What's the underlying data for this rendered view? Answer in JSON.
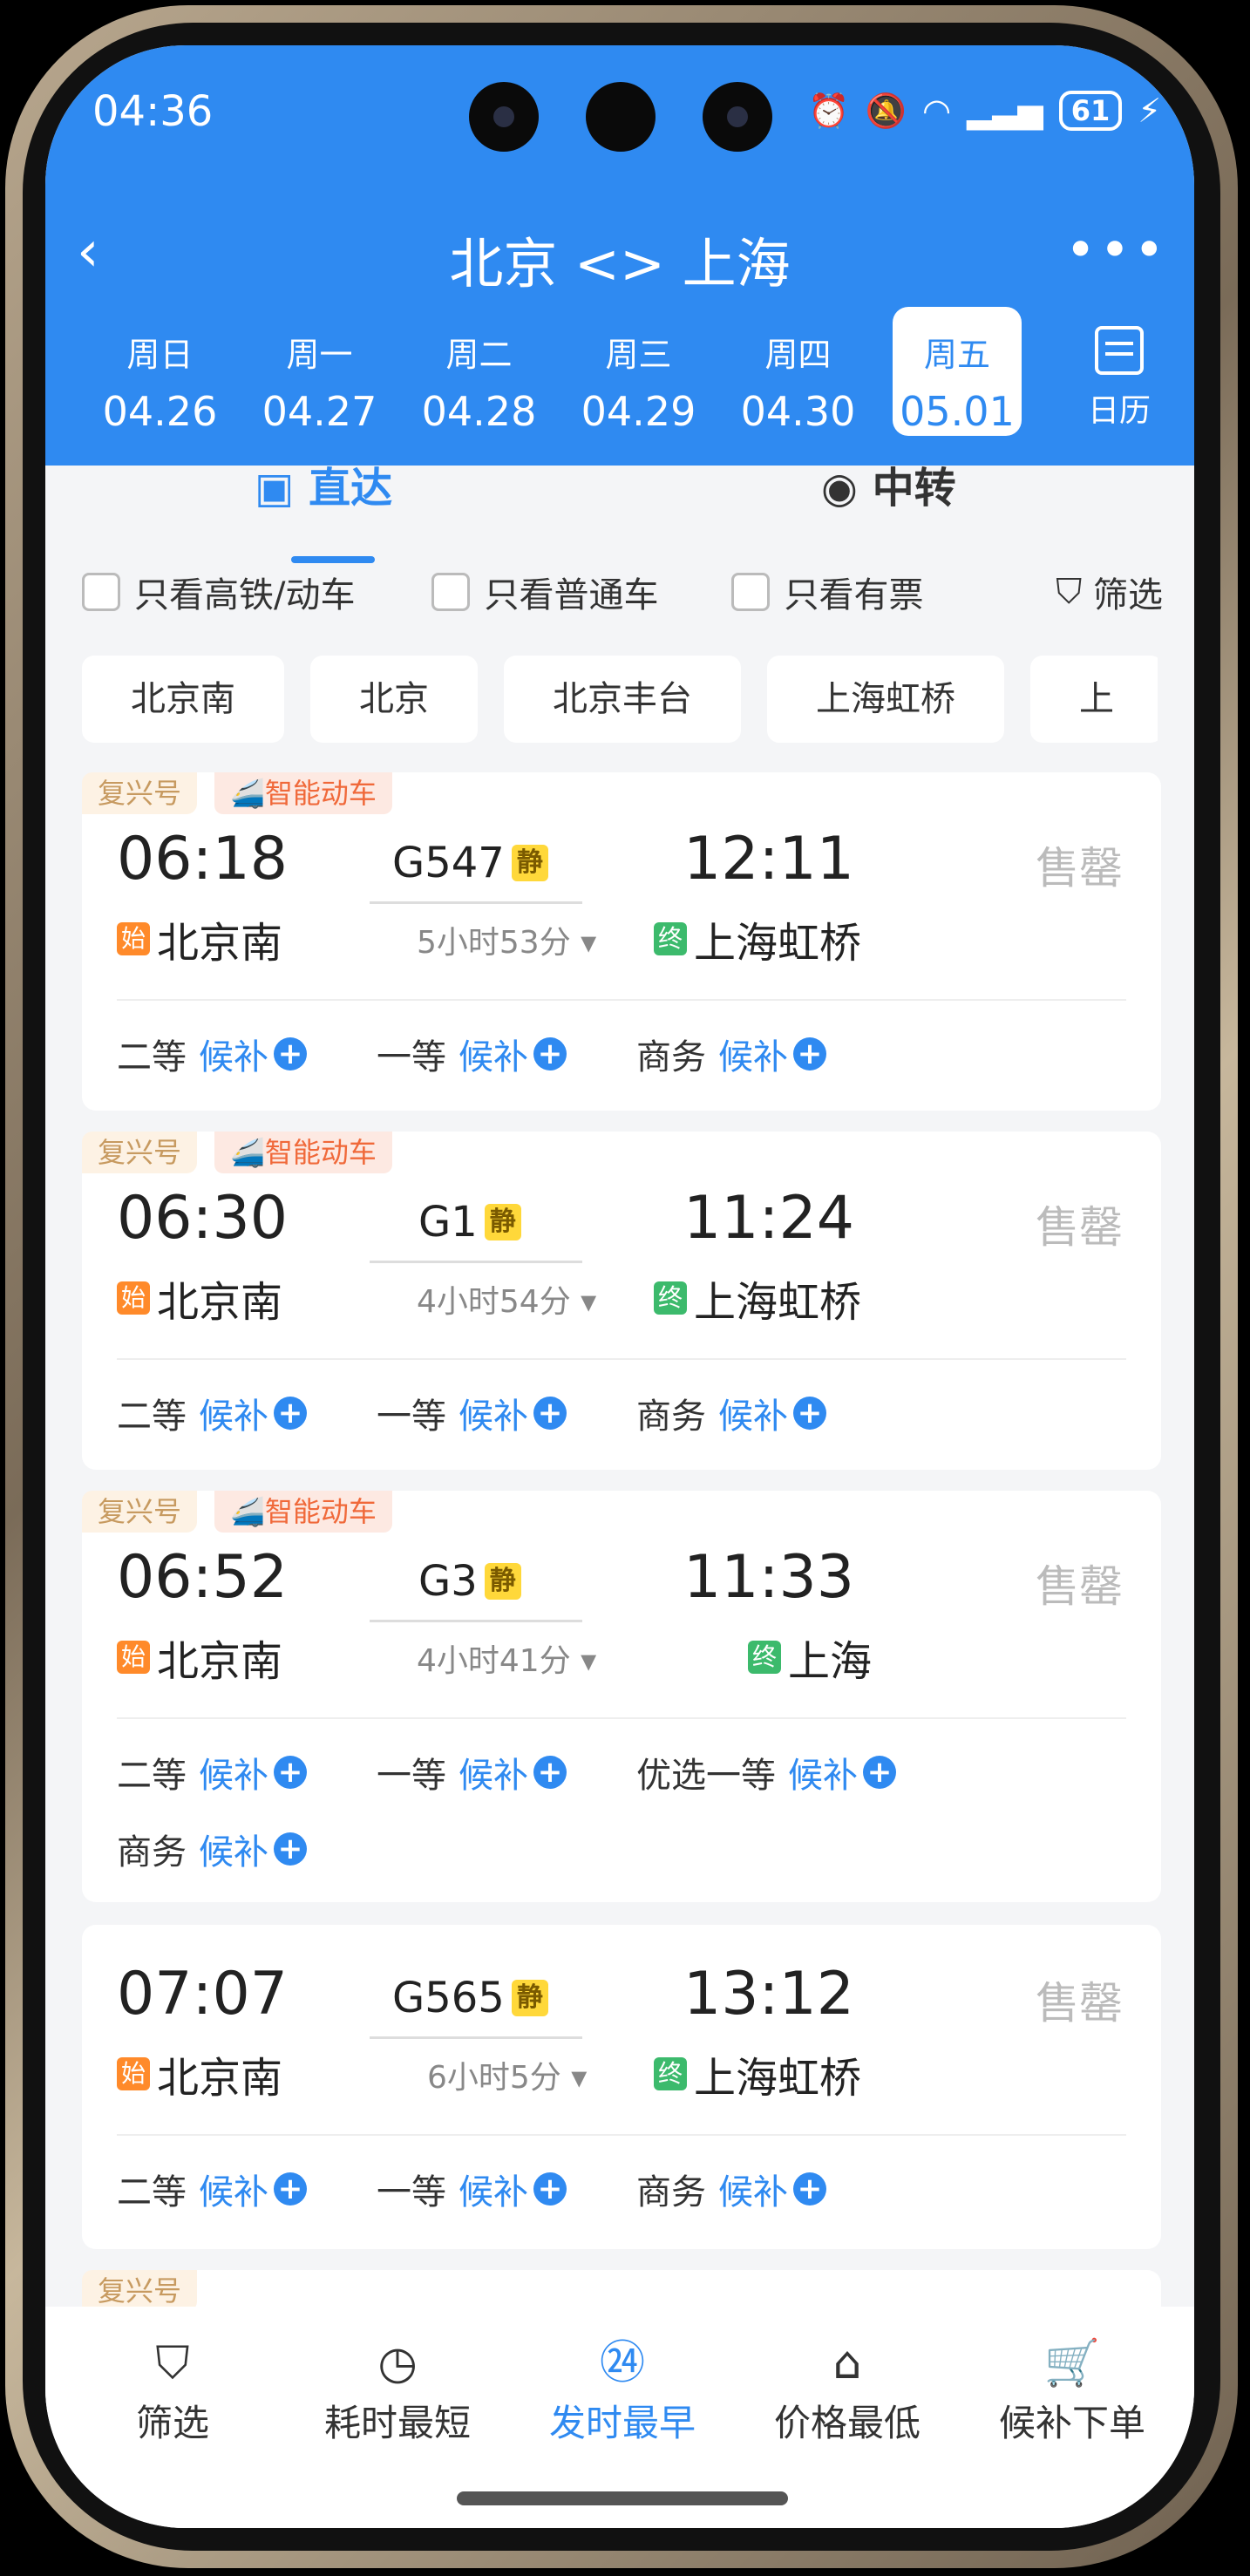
{
  "status_bar": {
    "time": "04:36",
    "battery": "61"
  },
  "nav": {
    "title": "北京 <> 上海",
    "back": "‹",
    "more": "•••"
  },
  "dates": [
    {
      "weekday": "周日",
      "date": "04.26"
    },
    {
      "weekday": "周一",
      "date": "04.27"
    },
    {
      "weekday": "周二",
      "date": "04.28"
    },
    {
      "weekday": "周三",
      "date": "04.29"
    },
    {
      "weekday": "周四",
      "date": "04.30"
    },
    {
      "weekday": "周五",
      "date": "05.01",
      "selected": true
    }
  ],
  "calendar_label": "日历",
  "tabs": {
    "direct": "直达",
    "transfer": "中转"
  },
  "filters": {
    "high_speed": "只看高铁/动车",
    "normal": "只看普通车",
    "available": "只看有票",
    "filter": "筛选"
  },
  "stations": [
    "北京南",
    "北京",
    "北京丰台",
    "上海虹桥",
    "上"
  ],
  "trains": [
    {
      "badges": [
        "复兴号",
        "智能动车"
      ],
      "dep_time": "06:18",
      "dep_station": "北京南",
      "train_no": "G547",
      "quiet": "静",
      "duration": "5小时53分",
      "arr_time": "12:11",
      "arr_station": "上海虹桥",
      "status": "售罄",
      "seats": [
        [
          "二等",
          "候补"
        ],
        [
          "一等",
          "候补"
        ],
        [
          "商务",
          "候补"
        ]
      ]
    },
    {
      "badges": [
        "复兴号",
        "智能动车"
      ],
      "dep_time": "06:30",
      "dep_station": "北京南",
      "train_no": "G1",
      "quiet": "静",
      "duration": "4小时54分",
      "arr_time": "11:24",
      "arr_station": "上海虹桥",
      "status": "售罄",
      "seats": [
        [
          "二等",
          "候补"
        ],
        [
          "一等",
          "候补"
        ],
        [
          "商务",
          "候补"
        ]
      ]
    },
    {
      "badges": [
        "复兴号",
        "智能动车"
      ],
      "dep_time": "06:52",
      "dep_station": "北京南",
      "train_no": "G3",
      "quiet": "静",
      "duration": "4小时41分",
      "arr_time": "11:33",
      "arr_station": "上海",
      "status": "售罄",
      "seats": [
        [
          "二等",
          "候补"
        ],
        [
          "一等",
          "候补"
        ],
        [
          "优选一等",
          "候补"
        ],
        [
          "商务",
          "候补"
        ]
      ]
    },
    {
      "badges": [],
      "dep_time": "07:07",
      "dep_station": "北京南",
      "train_no": "G565",
      "quiet": "静",
      "duration": "6小时5分",
      "arr_time": "13:12",
      "arr_station": "上海虹桥",
      "status": "售罄",
      "seats": [
        [
          "二等",
          "候补"
        ],
        [
          "一等",
          "候补"
        ],
        [
          "商务",
          "候补"
        ]
      ]
    }
  ],
  "station_tags": {
    "start": "始",
    "end": "终"
  },
  "partial_badge": "复兴号",
  "bottom_bar": [
    {
      "label": "筛选",
      "icon": "funnel-icon"
    },
    {
      "label": "耗时最短",
      "icon": "clock-icon"
    },
    {
      "label": "发时最早",
      "icon": "24-clock-icon",
      "active": true
    },
    {
      "label": "价格最低",
      "icon": "price-tag-icon"
    },
    {
      "label": "候补下单",
      "icon": "cart-icon"
    }
  ],
  "colors": {
    "primary": "#2f8af1",
    "sold_out": "#bbbbbb",
    "start_tag": "#ff8a2a",
    "end_tag": "#3cba6c"
  }
}
